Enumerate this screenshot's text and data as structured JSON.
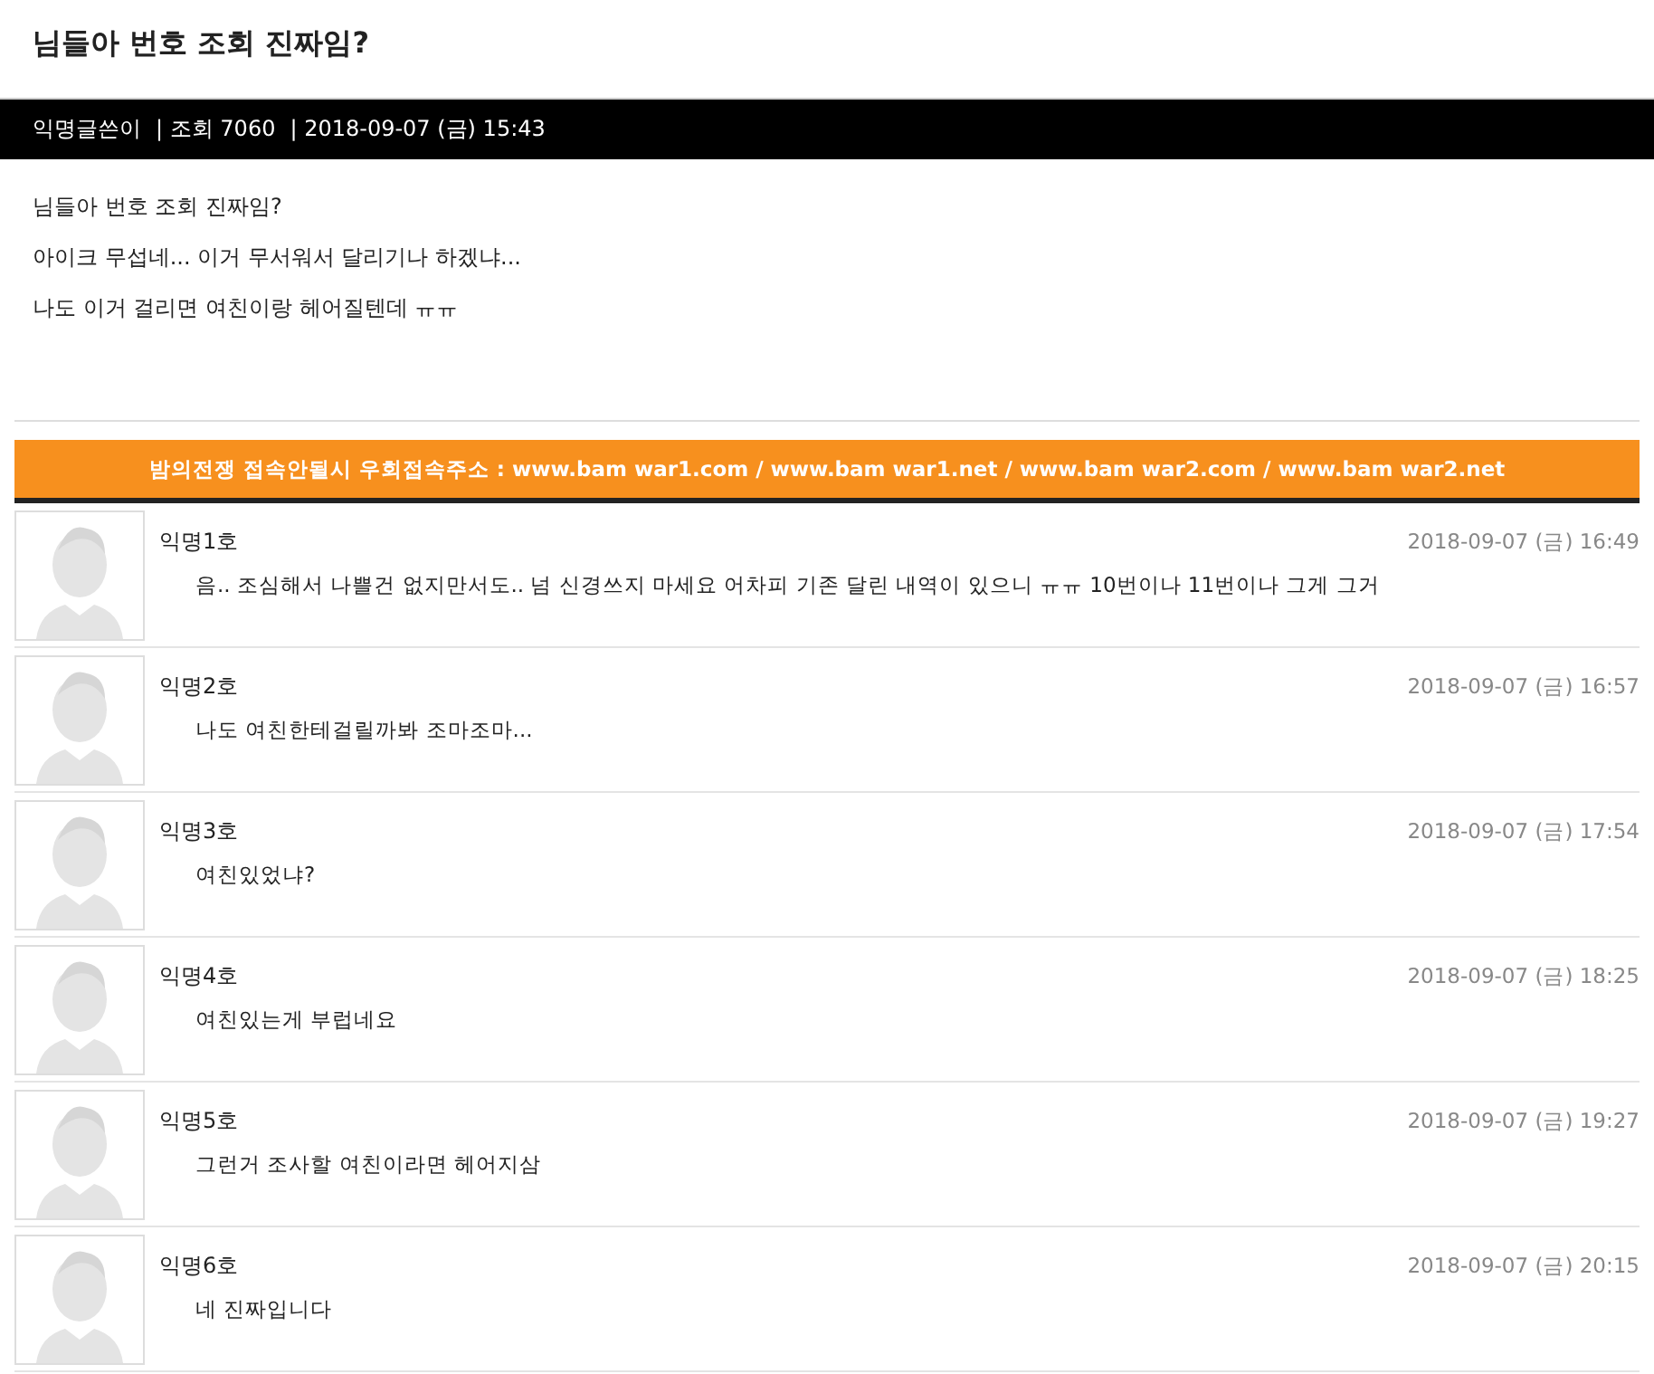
{
  "post": {
    "title": "님들아 번호 조회 진짜임?",
    "author": "익명글쓴이",
    "views": "| 조회 7060",
    "date": "| 2018-09-07 (금) 15:43",
    "body": [
      "님들아 번호 조회 진짜임?",
      "아이크 무섭네... 이거 무서워서 달리기나 하겠냐...",
      "나도 이거 걸리면 여친이랑 헤어질텐데 ㅠㅠ"
    ]
  },
  "banner": "밤의전쟁 접속안될시 우회접속주소 : www.bam war1.com / www.bam war1.net / www.bam war2.com / www.bam war2.net",
  "comments": [
    {
      "name": "익명1호",
      "time": "2018-09-07 (금) 16:49",
      "text": "음.. 조심해서 나쁠건 없지만서도.. 넘 신경쓰지 마세요 어차피 기존 달린 내역이 있으니 ㅠㅠ 10번이나 11번이나 그게 그거"
    },
    {
      "name": "익명2호",
      "time": "2018-09-07 (금) 16:57",
      "text": "나도 여친한테걸릴까봐 조마조마..."
    },
    {
      "name": "익명3호",
      "time": "2018-09-07 (금) 17:54",
      "text": "여친있었냐?"
    },
    {
      "name": "익명4호",
      "time": "2018-09-07 (금) 18:25",
      "text": "여친있는게 부럽네요"
    },
    {
      "name": "익명5호",
      "time": "2018-09-07 (금) 19:27",
      "text": "그런거 조사할 여친이라면 헤어지삼"
    },
    {
      "name": "익명6호",
      "time": "2018-09-07 (금) 20:15",
      "text": "네 진짜입니다"
    }
  ]
}
